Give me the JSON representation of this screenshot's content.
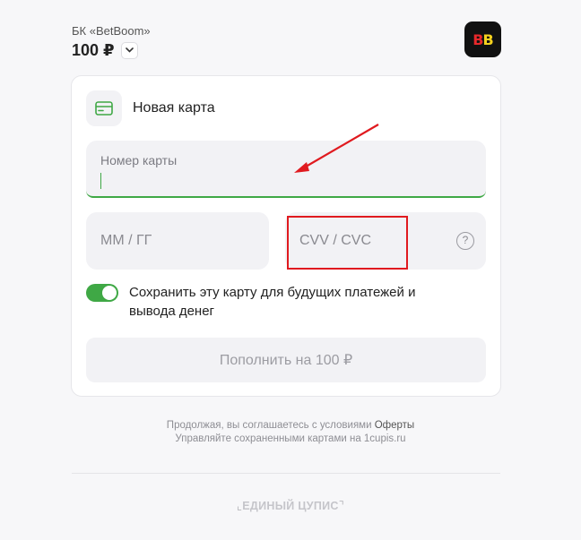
{
  "merchant": {
    "name": "БК «BetBoom»",
    "amount": "100 ₽",
    "logo_text_1": "B",
    "logo_text_2": "B"
  },
  "card_form": {
    "title": "Новая карта",
    "card_icon": "credit-card-icon",
    "number_label": "Номер карты",
    "number_value": "",
    "date_placeholder": "ММ / ГГ",
    "cvv_placeholder": "CVV / CVC",
    "help_symbol": "?",
    "save_label": "Сохранить эту карту для будущих платежей и вывода денег",
    "save_enabled": true,
    "pay_label": "Пополнить на 100 ₽"
  },
  "terms": {
    "line1_prefix": "Продолжая, вы соглашаетесь с условиями ",
    "line1_link": "Оферты",
    "line2": "Управляйте сохраненными картами на 1cupis.ru"
  },
  "footer": {
    "brand": "ЕДИНЫЙ ЦУПИС"
  },
  "colors": {
    "accent_green": "#3fa845",
    "annotation_red": "#e01a1f",
    "background": "#f7f7f9"
  }
}
